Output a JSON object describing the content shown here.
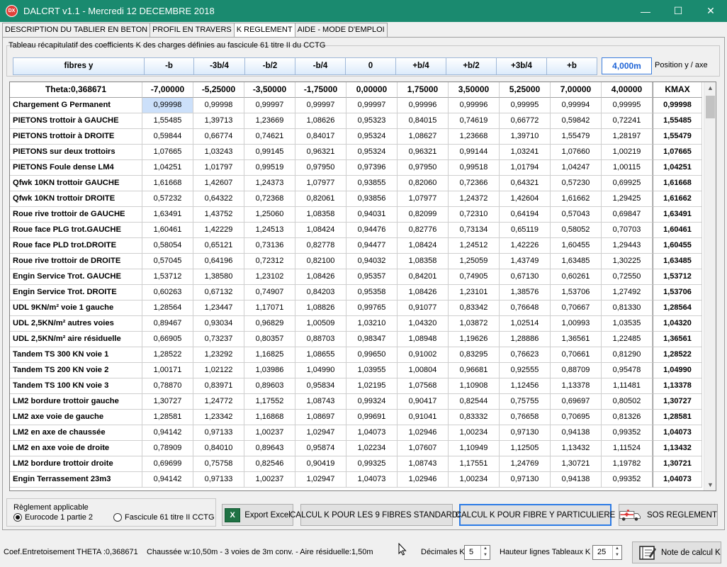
{
  "window": {
    "title": "DALCRT v1.1 - Mercredi 12 DECEMBRE 2018",
    "app_icon": "DX",
    "minimize": "—",
    "maximize": "☐",
    "close": "✕"
  },
  "tabs": [
    {
      "label": "DESCRIPTION DU TABLIER EN BETON"
    },
    {
      "label": "PROFIL EN TRAVERS"
    },
    {
      "label": "K REGLEMENT"
    },
    {
      "label": "AIDE - MODE D'EMPLOI"
    }
  ],
  "group_title": "Tableau récapitulatif des coefficients K des charges définies au fascicule 61 titre II du CCTG",
  "fibres": {
    "labels": [
      "fibres y",
      "-b",
      "-3b/4",
      "-b/2",
      "-b/4",
      "0",
      "+b/4",
      "+b/2",
      "+3b/4",
      "+b"
    ],
    "position_value": "4,000m",
    "position_label": "Position y / axe"
  },
  "table": {
    "headers": [
      "Theta:0,368671",
      "-7,00000",
      "-5,25000",
      "-3,50000",
      "-1,75000",
      "0,00000",
      "1,75000",
      "3,50000",
      "5,25000",
      "7,00000",
      "4,00000",
      "KMAX"
    ],
    "rows": [
      [
        "Chargement G Permanent",
        "0,99998",
        "0,99998",
        "0,99997",
        "0,99997",
        "0,99997",
        "0,99996",
        "0,99996",
        "0,99995",
        "0,99994",
        "0,99995",
        "0,99998"
      ],
      [
        "PIETONS trottoir à GAUCHE",
        "1,55485",
        "1,39713",
        "1,23669",
        "1,08626",
        "0,95323",
        "0,84015",
        "0,74619",
        "0,66772",
        "0,59842",
        "0,72241",
        "1,55485"
      ],
      [
        "PIETONS trottoir à DROITE",
        "0,59844",
        "0,66774",
        "0,74621",
        "0,84017",
        "0,95324",
        "1,08627",
        "1,23668",
        "1,39710",
        "1,55479",
        "1,28197",
        "1,55479"
      ],
      [
        "PIETONS sur deux trottoirs",
        "1,07665",
        "1,03243",
        "0,99145",
        "0,96321",
        "0,95324",
        "0,96321",
        "0,99144",
        "1,03241",
        "1,07660",
        "1,00219",
        "1,07665"
      ],
      [
        "PIETONS Foule dense LM4",
        "1,04251",
        "1,01797",
        "0,99519",
        "0,97950",
        "0,97396",
        "0,97950",
        "0,99518",
        "1,01794",
        "1,04247",
        "1,00115",
        "1,04251"
      ],
      [
        "Qfwk 10KN trottoir GAUCHE",
        "1,61668",
        "1,42607",
        "1,24373",
        "1,07977",
        "0,93855",
        "0,82060",
        "0,72366",
        "0,64321",
        "0,57230",
        "0,69925",
        "1,61668"
      ],
      [
        "Qfwk 10KN trottoir DROITE",
        "0,57232",
        "0,64322",
        "0,72368",
        "0,82061",
        "0,93856",
        "1,07977",
        "1,24372",
        "1,42604",
        "1,61662",
        "1,29425",
        "1,61662"
      ],
      [
        "Roue rive trottoir de GAUCHE",
        "1,63491",
        "1,43752",
        "1,25060",
        "1,08358",
        "0,94031",
        "0,82099",
        "0,72310",
        "0,64194",
        "0,57043",
        "0,69847",
        "1,63491"
      ],
      [
        "Roue face PLG trot.GAUCHE",
        "1,60461",
        "1,42229",
        "1,24513",
        "1,08424",
        "0,94476",
        "0,82776",
        "0,73134",
        "0,65119",
        "0,58052",
        "0,70703",
        "1,60461"
      ],
      [
        "Roue face PLD trot.DROITE",
        "0,58054",
        "0,65121",
        "0,73136",
        "0,82778",
        "0,94477",
        "1,08424",
        "1,24512",
        "1,42226",
        "1,60455",
        "1,29443",
        "1,60455"
      ],
      [
        "Roue rive trottoir de DROITE",
        "0,57045",
        "0,64196",
        "0,72312",
        "0,82100",
        "0,94032",
        "1,08358",
        "1,25059",
        "1,43749",
        "1,63485",
        "1,30225",
        "1,63485"
      ],
      [
        "Engin Service Trot. GAUCHE",
        "1,53712",
        "1,38580",
        "1,23102",
        "1,08426",
        "0,95357",
        "0,84201",
        "0,74905",
        "0,67130",
        "0,60261",
        "0,72550",
        "1,53712"
      ],
      [
        "Engin Service Trot. DROITE",
        "0,60263",
        "0,67132",
        "0,74907",
        "0,84203",
        "0,95358",
        "1,08426",
        "1,23101",
        "1,38576",
        "1,53706",
        "1,27492",
        "1,53706"
      ],
      [
        "UDL 9KN/m² voie 1 gauche",
        "1,28564",
        "1,23447",
        "1,17071",
        "1,08826",
        "0,99765",
        "0,91077",
        "0,83342",
        "0,76648",
        "0,70667",
        "0,81330",
        "1,28564"
      ],
      [
        "UDL 2,5KN/m² autres voies",
        "0,89467",
        "0,93034",
        "0,96829",
        "1,00509",
        "1,03210",
        "1,04320",
        "1,03872",
        "1,02514",
        "1,00993",
        "1,03535",
        "1,04320"
      ],
      [
        "UDL 2,5KN/m² aire résiduelle",
        "0,66905",
        "0,73237",
        "0,80357",
        "0,88703",
        "0,98347",
        "1,08948",
        "1,19626",
        "1,28886",
        "1,36561",
        "1,22485",
        "1,36561"
      ],
      [
        "Tandem TS 300 KN voie 1",
        "1,28522",
        "1,23292",
        "1,16825",
        "1,08655",
        "0,99650",
        "0,91002",
        "0,83295",
        "0,76623",
        "0,70661",
        "0,81290",
        "1,28522"
      ],
      [
        "Tandem TS 200 KN voie 2",
        "1,00171",
        "1,02122",
        "1,03986",
        "1,04990",
        "1,03955",
        "1,00804",
        "0,96681",
        "0,92555",
        "0,88709",
        "0,95478",
        "1,04990"
      ],
      [
        "Tandem TS 100 KN voie 3",
        "0,78870",
        "0,83971",
        "0,89603",
        "0,95834",
        "1,02195",
        "1,07568",
        "1,10908",
        "1,12456",
        "1,13378",
        "1,11481",
        "1,13378"
      ],
      [
        "LM2 bordure trottoir gauche",
        "1,30727",
        "1,24772",
        "1,17552",
        "1,08743",
        "0,99324",
        "0,90417",
        "0,82544",
        "0,75755",
        "0,69697",
        "0,80502",
        "1,30727"
      ],
      [
        "LM2 axe voie de gauche",
        "1,28581",
        "1,23342",
        "1,16868",
        "1,08697",
        "0,99691",
        "0,91041",
        "0,83332",
        "0,76658",
        "0,70695",
        "0,81326",
        "1,28581"
      ],
      [
        "LM2 en axe de chaussée",
        "0,94142",
        "0,97133",
        "1,00237",
        "1,02947",
        "1,04073",
        "1,02946",
        "1,00234",
        "0,97130",
        "0,94138",
        "0,99352",
        "1,04073"
      ],
      [
        "LM2 en axe voie de droite",
        "0,78909",
        "0,84010",
        "0,89643",
        "0,95874",
        "1,02234",
        "1,07607",
        "1,10949",
        "1,12505",
        "1,13432",
        "1,11524",
        "1,13432"
      ],
      [
        "LM2 bordure trottoir droite",
        "0,69699",
        "0,75758",
        "0,82546",
        "0,90419",
        "0,99325",
        "1,08743",
        "1,17551",
        "1,24769",
        "1,30721",
        "1,19782",
        "1,30721"
      ],
      [
        "Engin Terrassement 23m3",
        "0,94142",
        "0,97133",
        "1,00237",
        "1,02947",
        "1,04073",
        "1,02946",
        "1,00234",
        "0,97130",
        "0,94138",
        "0,99352",
        "1,04073"
      ]
    ]
  },
  "reglement": {
    "title": "Règlement applicable",
    "option1": "Eurocode 1 partie 2",
    "option2": "Fascicule 61 titre II CCTG"
  },
  "buttons": {
    "export_excel": "Export Excel",
    "calcul_9": "CALCUL K POUR LES 9 FIBRES STANDARDS",
    "calcul_y": "CALCUL K POUR FIBRE Y PARTICULIERE",
    "sos": "SOS REGLEMENT",
    "note": "Note de calcul K"
  },
  "status": {
    "coef": "Coef.Entretoisement THETA :0,368671",
    "chaussee": "Chaussée w:10,50m - 3 voies de 3m conv. - Aire résiduelle:1,50m",
    "decimales_label": "Décimales K",
    "decimales_value": "5",
    "hauteur_label": "Hauteur lignes Tableaux K",
    "hauteur_value": "25"
  },
  "colors": {
    "titlebar": "#1a8a6f",
    "selection": "#cce0fa",
    "accent": "#2c7be5"
  }
}
